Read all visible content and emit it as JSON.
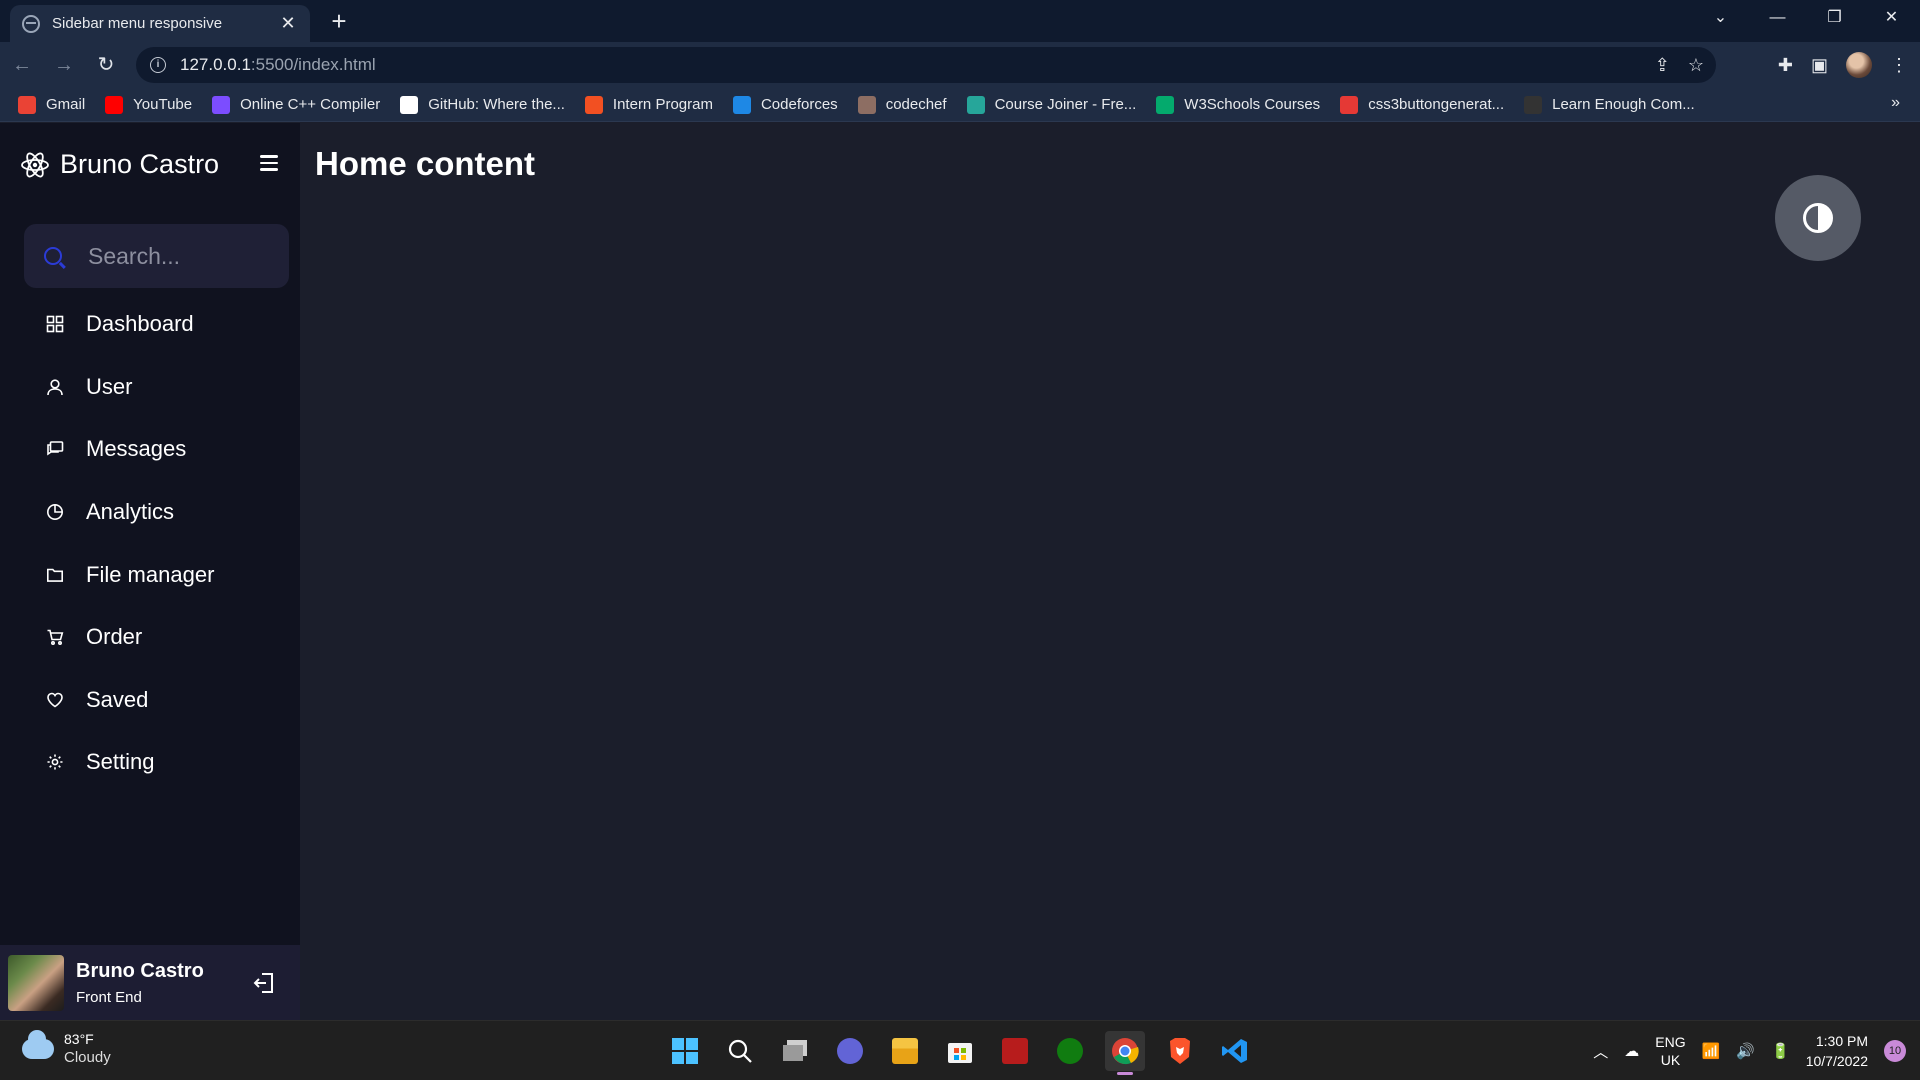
{
  "browser": {
    "tab_title": "Sidebar menu responsive",
    "url_host": "127.0.0.1",
    "url_path": ":5500/index.html",
    "bookmarks": [
      {
        "label": "Gmail",
        "icon": "gmail-icon",
        "color": "#ea4335"
      },
      {
        "label": "YouTube",
        "icon": "youtube-icon",
        "color": "#ff0000"
      },
      {
        "label": "Online C++ Compiler",
        "icon": "compiler-icon",
        "color": "#7c4dff"
      },
      {
        "label": "GitHub: Where the...",
        "icon": "github-icon",
        "color": "#ffffff"
      },
      {
        "label": "Intern Program",
        "icon": "microsoft-icon",
        "color": "#f25022"
      },
      {
        "label": "Codeforces",
        "icon": "codeforces-icon",
        "color": "#1e88e5"
      },
      {
        "label": "codechef",
        "icon": "codechef-icon",
        "color": "#8d6e63"
      },
      {
        "label": "Course Joiner - Fre...",
        "icon": "coursejoiner-icon",
        "color": "#26a69a"
      },
      {
        "label": "W3Schools Courses",
        "icon": "w3schools-icon",
        "color": "#04aa6d"
      },
      {
        "label": "css3buttongenerat...",
        "icon": "css3-icon",
        "color": "#e53935"
      },
      {
        "label": "Learn Enough Com...",
        "icon": "learnenough-icon",
        "color": "#333333"
      }
    ]
  },
  "sidebar": {
    "brand": "Bruno Castro",
    "search_placeholder": "Search...",
    "items": [
      {
        "label": "Dashboard",
        "icon": "dashboard-icon"
      },
      {
        "label": "User",
        "icon": "user-icon"
      },
      {
        "label": "Messages",
        "icon": "messages-icon"
      },
      {
        "label": "Analytics",
        "icon": "analytics-icon"
      },
      {
        "label": "File manager",
        "icon": "folder-icon"
      },
      {
        "label": "Order",
        "icon": "cart-icon"
      },
      {
        "label": "Saved",
        "icon": "heart-icon"
      },
      {
        "label": "Setting",
        "icon": "gear-icon"
      }
    ],
    "profile": {
      "name": "Bruno Castro",
      "role": "Front End"
    }
  },
  "main": {
    "title": "Home content"
  },
  "taskbar": {
    "weather_temp": "83°F",
    "weather_condition": "Cloudy",
    "lang_line1": "ENG",
    "lang_line2": "UK",
    "time": "1:30 PM",
    "date": "10/7/2022",
    "notification_count": "10"
  },
  "colors": {
    "sidebar_bg": "#10121f",
    "main_bg": "#1b1e2b",
    "search_bg": "#1f2036",
    "accent_search": "#2b3bd6",
    "profile_bg": "#1d1d33",
    "toggle_bg": "#555a66"
  }
}
